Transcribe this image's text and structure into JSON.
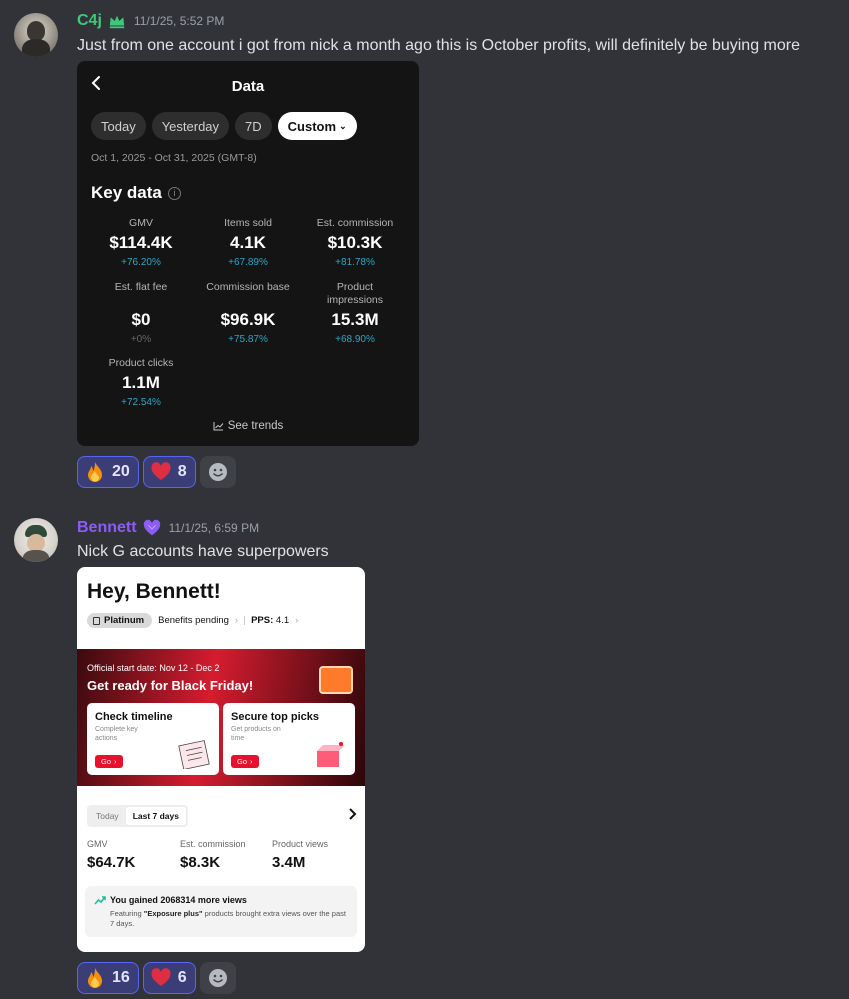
{
  "messages": [
    {
      "author": "C4j",
      "author_color": "#3ec97a",
      "badge": "crown-icon",
      "timestamp": "11/1/25, 5:52 PM",
      "text": "Just from one account i got from nick a month ago this is October profits, will definitely be buying more",
      "attachment": {
        "title": "Data",
        "chips": [
          "Today",
          "Yesterday",
          "7D",
          "Custom"
        ],
        "active_chip": "Custom",
        "date_range": "Oct 1, 2025 - Oct 31, 2025 (GMT-8)",
        "section_title": "Key data",
        "metrics": [
          {
            "label": "GMV",
            "value": "$114.4K",
            "change": "+76.20%"
          },
          {
            "label": "Items sold",
            "value": "4.1K",
            "change": "+67.89%"
          },
          {
            "label": "Est. commission",
            "value": "$10.3K",
            "change": "+81.78%"
          },
          {
            "label": "Est. flat fee",
            "value": "$0",
            "change": "+0%"
          },
          {
            "label": "Commission base",
            "value": "$96.9K",
            "change": "+75.87%"
          },
          {
            "label": "Product impressions",
            "value": "15.3M",
            "change": "+68.90%"
          },
          {
            "label": "Product clicks",
            "value": "1.1M",
            "change": "+72.54%"
          }
        ],
        "see_trends": "See trends"
      },
      "reactions": [
        {
          "emoji": "fire",
          "count": "20"
        },
        {
          "emoji": "heart",
          "count": "8"
        }
      ]
    },
    {
      "author": "Bennett",
      "author_color": "#8b5cf6",
      "badge": "heart-icon",
      "timestamp": "11/1/25, 6:59 PM",
      "text": "Nick G accounts have superpowers",
      "attachment": {
        "greeting": "Hey, Bennett!",
        "tier": "Platinum",
        "benefits": "Benefits pending",
        "pps_label": "PPS:",
        "pps_value": "4.1",
        "banner_small": "Official start date: Nov 12 - Dec 2",
        "banner_big": "Get ready for Black Friday!",
        "cards": [
          {
            "title": "Check timeline",
            "subtitle": "Complete key actions",
            "button": "Go"
          },
          {
            "title": "Secure top picks",
            "subtitle": "Get products on time",
            "button": "Go"
          }
        ],
        "tabs": [
          "Today",
          "Last 7 days"
        ],
        "active_tab": "Last 7 days",
        "metrics": [
          {
            "label": "GMV",
            "value": "$64.7K"
          },
          {
            "label": "Est. commission",
            "value": "$8.3K"
          },
          {
            "label": "Product views",
            "value": "3.4M"
          }
        ],
        "gained_title": "You gained 2068314 more views",
        "gained_pre": "Featuring ",
        "gained_bold": "\"Exposure plus\"",
        "gained_post": " products brought extra views over the past 7 days."
      },
      "reactions": [
        {
          "emoji": "fire",
          "count": "16"
        },
        {
          "emoji": "heart",
          "count": "6"
        }
      ]
    }
  ]
}
